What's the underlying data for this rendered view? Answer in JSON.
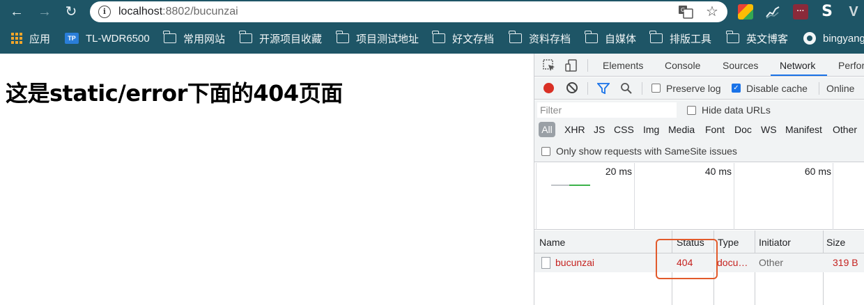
{
  "browser": {
    "url_host": "localhost",
    "url_path": ":8802/bucunzai",
    "info_glyph": "i",
    "nav": {
      "back": "←",
      "forward": "→",
      "reload": "↻"
    },
    "star_glyph": "☆",
    "ext_c_text": "···",
    "ext_d_text": "S",
    "ext_e_text": "V"
  },
  "bookmarks": {
    "apps": "应用",
    "tp_badge": "TP",
    "items": [
      "TL-WDR6500",
      "常用网站",
      "开源项目收藏",
      "项目测试地址",
      "好文存档",
      "资料存档",
      "自媒体",
      "排版工具",
      "英文博客",
      "bingyang"
    ]
  },
  "page": {
    "heading": "这是static/error下面的404页面"
  },
  "devtools": {
    "tabs": [
      "Elements",
      "Console",
      "Sources",
      "Network",
      "Perfor"
    ],
    "active_tab": "Network",
    "toolbar": {
      "preserve_log": "Preserve log",
      "disable_cache": "Disable cache",
      "throttle": "Online",
      "check_glyph": "✓"
    },
    "filter": {
      "placeholder": "Filter",
      "hide_data_urls": "Hide data URLs"
    },
    "types": [
      "All",
      "XHR",
      "JS",
      "CSS",
      "Img",
      "Media",
      "Font",
      "Doc",
      "WS",
      "Manifest",
      "Other"
    ],
    "samesite": "Only show requests with SameSite issues",
    "timeline_labels": [
      "20 ms",
      "40 ms",
      "60 ms"
    ],
    "columns": [
      "Name",
      "Status",
      "Type",
      "Initiator",
      "Size"
    ],
    "rows": [
      {
        "name": "bucunzai",
        "status": "404",
        "type": "docu…",
        "initiator": "Other",
        "size": "319 B"
      }
    ]
  },
  "colors": {
    "chrome_bar": "#1e5566",
    "accent": "#1a73e8",
    "error": "#c5221f",
    "highlight": "#e25a2b"
  }
}
